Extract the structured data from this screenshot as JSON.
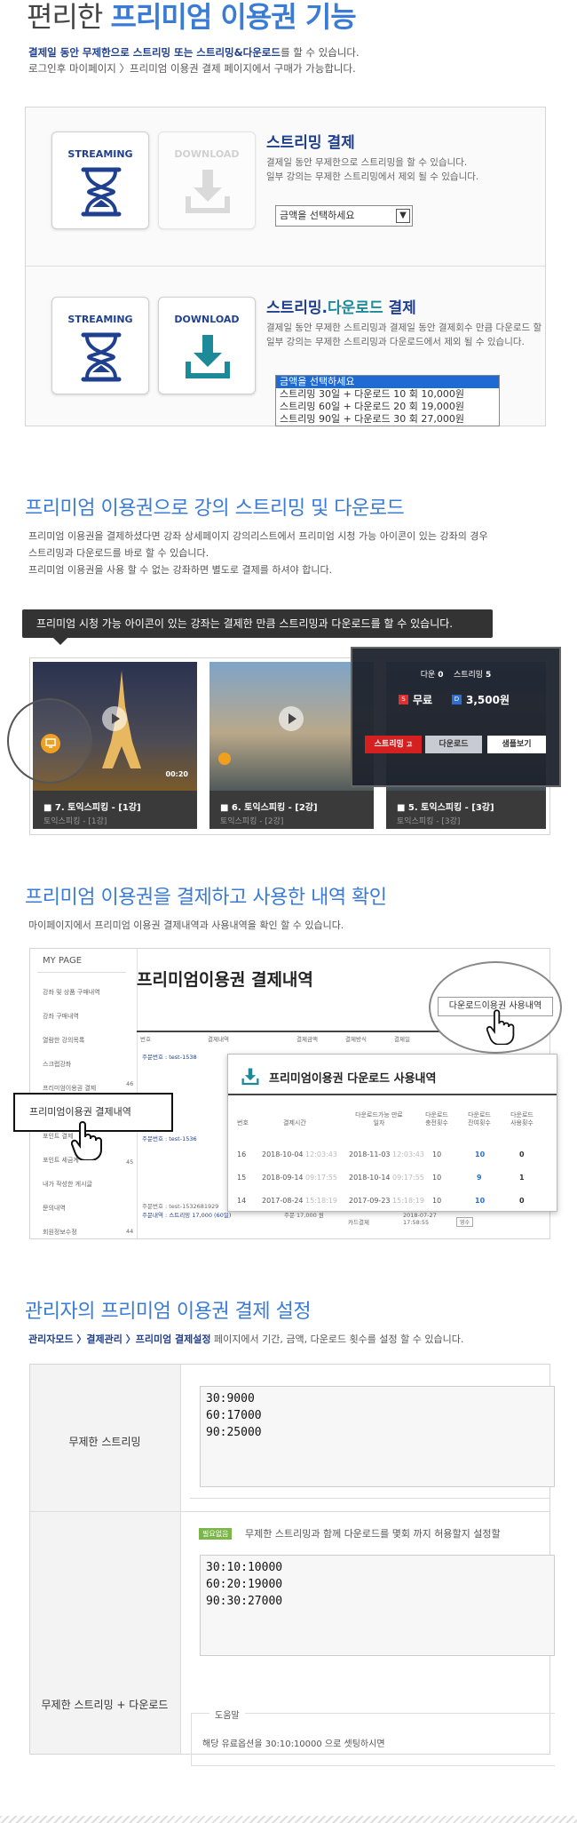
{
  "header": {
    "title_prefix": "편리한",
    "title_highlight": "프리미엄 이용권 기능",
    "intro_line1_bold": "결제일 동안 무제한으로 스트리밍 또는 스트리밍&다운로드",
    "intro_line1_rest": "를 할 수 있습니다.",
    "intro_line2": "로그인후 마이페이지 〉프리미엄 이용권 결제 페이지에서 구매가 가능합니다."
  },
  "payment": {
    "streaming_label": "STREAMING",
    "download_label": "DOWNLOAD",
    "option1": {
      "title": "스트리밍 결제",
      "desc1": "결제일 동안 무제한으로 스트리밍을 할 수 있습니다.",
      "desc2": "일부 강의는 무제한 스트리밍에서 제외 될 수 있습니다.",
      "select_placeholder": "금액을 선택하세요"
    },
    "option2": {
      "title_a": "스트리밍.",
      "title_b": "다운로드",
      "title_c": " 결제",
      "desc1": "결제일 동안 무제한 스트리밍과 결제일 동안 결제회수 만큼 다운로드 할 수 있습니다.",
      "desc2": "일부 강의는 무제한 스트리밍과 다운로드에서 제외 될 수 있습니다.",
      "options": [
        "금액을 선택하세요",
        "스트리밍 30일 + 다운로드 10 회 10,000원",
        "스트리밍 60일 + 다운로드 20 회 19,000원",
        "스트리밍 90일 + 다운로드 30 회 27,000원"
      ]
    }
  },
  "section2": {
    "title": "프리미엄 이용권으로 강의 스트리밍 및 다운로드",
    "line1": "프리미엄 이용권을 결제하셨다면 강좌 상세페이지 강의리스트에서 프리미엄 시청 가능 아이콘이 있는 강좌의 경우",
    "line2": "스트리밍과 다운로드를 바로 할 수 있습니다.",
    "line3": "프리미엄 이용권을 사용 할 수 없는 강좌하면 별도로 결제를 하셔야 합니다.",
    "tooltip": "프리미엄 시청 가능 아이콘이 있는 강좌는 결제한 만큼 스트리밍과 다운로드를 할 수 있습니다.",
    "thumbs": [
      {
        "title": "■ 7. 토익스피킹 - [1강]",
        "sub": "토익스피킹 - [1강]",
        "time": "00:20"
      },
      {
        "title": "■ 6. 토익스피킹 - [2강]",
        "sub": "토익스피킹 - [2강]"
      },
      {
        "title": "■ 5. 토익스피킹 - [3강]",
        "sub": "토익스피킹 - [3강]"
      }
    ],
    "popup": {
      "down_label": "다운",
      "down_count": "0",
      "stream_label": "스트리밍",
      "stream_count": "5",
      "free_badge": "S",
      "free": "무료",
      "price_badge": "D",
      "price": "3,500원",
      "btn_stream": "스트리밍",
      "btn_stream_badge": "고",
      "btn_download": "다운로드",
      "btn_sample": "샘플보기"
    }
  },
  "section3": {
    "title": "프리미엄 이용권을 결제하고 사용한 내역 확인",
    "desc": "마이페이지에서 프리미엄 이용권 결제내역과 사용내역을 확인 할 수 있습니다.",
    "mypage": "MY PAGE",
    "sidebar": [
      "강좌 및 상품 구매내역",
      "강좌 구매내역",
      "열람한 강의목록",
      "스크랩강좌",
      "프리미엄이용권 결제",
      "프리미엄이용권 결제내역",
      "포인트 결제",
      "포인트 세금계",
      "내가 작성한 게시글",
      "문의내역",
      "회원정보수정"
    ],
    "callout": "프리미엄이용권 결제내역",
    "page_title": "프리미엄이용권 결제내역",
    "table_headers": [
      "번호",
      "결제내역",
      "결제금액",
      "결제방식",
      "결제일"
    ],
    "row_nums": [
      "46",
      "45",
      "44"
    ],
    "download_btn": "다운로드이용권 사용내역",
    "usage_title": "프리미엄이용권 다운로드 사용내역",
    "usage_headers": [
      "번호",
      "결제시간",
      "다운로드가능 만료일자",
      "다운로드 충전횟수",
      "다운로드 잔여횟수",
      "다운로드 사용횟수"
    ],
    "usage_rows": [
      {
        "no": "16",
        "date": "2018-10-04",
        "time": "12:03:43",
        "exp": "2018-11-03",
        "exp_time": "12:03:43",
        "charge": "10",
        "remain": "10",
        "used": "0"
      },
      {
        "no": "15",
        "date": "2018-09-14",
        "time": "09:17:55",
        "exp": "2018-10-14",
        "exp_time": "09:17:55",
        "charge": "10",
        "remain": "9",
        "used": "1"
      },
      {
        "no": "14",
        "date": "2017-08-24",
        "time": "15:18:19",
        "exp": "2017-09-23",
        "exp_time": "15:18:19",
        "charge": "10",
        "remain": "10",
        "used": "0"
      }
    ],
    "order_label1": "주문번호 : test-1538",
    "order_label2": "주문번호 : test-1536",
    "order_label3": "주문번호 : test-1532681929",
    "order_items": "주문내역 : 스트리밍 17,000 (60일)",
    "row3_amount": "주문 17,000 원",
    "row3_method": "카드결제",
    "row3_date": "2018-07-27 17:58:55",
    "row3_btn": "영수"
  },
  "section4": {
    "title": "관리자의 프리미엄 이용권 결제 설정",
    "desc_bold": "관리자모드 〉결제관리 〉프리미엄 결제설정",
    "desc_rest": " 페이지에서 기간, 금액, 다운로드 횟수를 설정 할 수 있습니다.",
    "row1_label": "무제한 스트리밍",
    "row1_value": "30:9000\n60:17000\n90:25000",
    "row2_label": "무제한 스트리밍 + 다운로드",
    "row2_badge": "필요없음",
    "row2_hint": "무제한 스트리밍과 함께 다운로드를 몇회 까지 허용할지 설정할",
    "row2_value": "30:10:10000\n60:20:19000\n90:30:27000",
    "help_label": "도움말",
    "help_text": "해당 유료옵션을 30:10:10000 으로 셋팅하시면"
  }
}
